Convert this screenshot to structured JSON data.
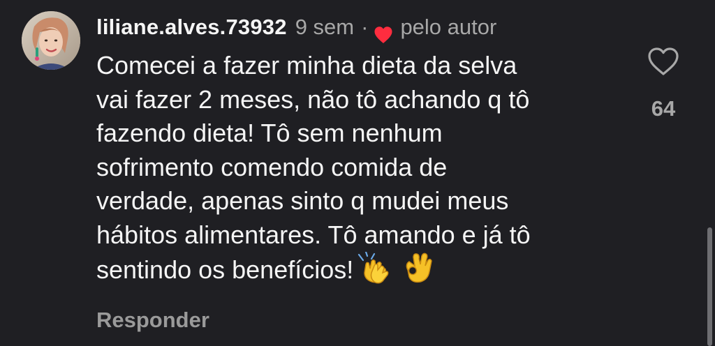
{
  "comment": {
    "username": "liliane.alves.73932",
    "time": "9 sem",
    "separator": "·",
    "liked_by_author": "pelo autor",
    "text_lines": [
      "Comecei a fazer minha dieta da selva",
      "vai fazer 2 meses, não tô achando q tô",
      "fazendo dieta! Tô sem nenhum",
      "sofrimento comendo comida de",
      "verdade, apenas sinto q mudei meus",
      "hábitos alimentares. Tô amando e já tô",
      "sentindo os benefícios!"
    ],
    "emojis": [
      "clapping-hands-emoji",
      "ok-hand-emoji"
    ],
    "reply_label": "Responder",
    "like_count": "64"
  },
  "icons": {
    "author_heart": "heart-filled-icon",
    "like": "heart-outline-icon"
  },
  "colors": {
    "background": "#1f1f23",
    "primary_text": "#f5f5f5",
    "secondary_text": "#a8a8a8",
    "heart_red": "#ff2d3f"
  }
}
